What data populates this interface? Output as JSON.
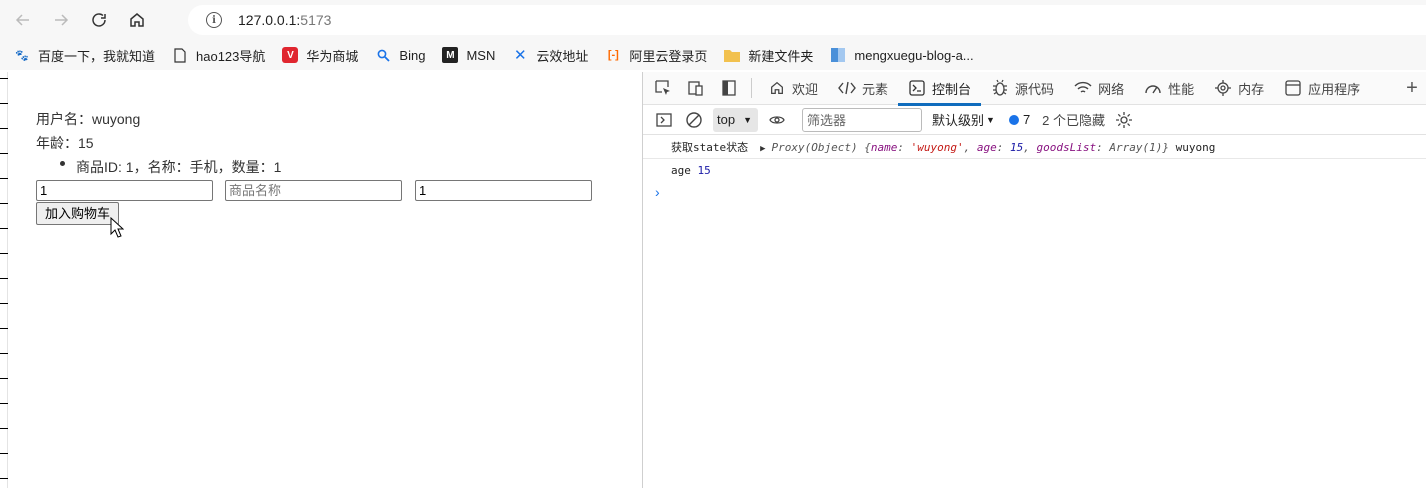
{
  "browser": {
    "address_host": "127.0.0.1:",
    "address_port": "5173"
  },
  "bookmarks": [
    {
      "label": "百度一下，我就知道",
      "icon": "baidu-icon"
    },
    {
      "label": "hao123导航",
      "icon": "page-icon"
    },
    {
      "label": "华为商城",
      "icon": "huawei-icon"
    },
    {
      "label": "Bing",
      "icon": "bing-search-icon"
    },
    {
      "label": "MSN",
      "icon": "msn-icon"
    },
    {
      "label": "云效地址",
      "icon": "yunxiao-icon"
    },
    {
      "label": "阿里云登录页",
      "icon": "aliyun-icon"
    },
    {
      "label": "新建文件夹",
      "icon": "folder-icon"
    },
    {
      "label": "mengxuegu-blog-a...",
      "icon": "app-icon"
    }
  ],
  "page": {
    "username_line": "用户名：wuyong",
    "age_line": "年龄：15",
    "goods_item": "商品ID: 1，名称：手机，数量：1",
    "input_id_value": "1",
    "input_name_placeholder": "商品名称",
    "input_qty_value": "1",
    "add_button": "加入购物车"
  },
  "devtools": {
    "tabs": [
      {
        "label": "欢迎",
        "icon": "home-icon"
      },
      {
        "label": "元素",
        "icon": "code-icon"
      },
      {
        "label": "控制台",
        "icon": "console-icon",
        "active": true
      },
      {
        "label": "源代码",
        "icon": "bug-icon"
      },
      {
        "label": "网络",
        "icon": "wifi-icon"
      },
      {
        "label": "性能",
        "icon": "performance-icon"
      },
      {
        "label": "内存",
        "icon": "memory-chip-icon"
      },
      {
        "label": "应用程序",
        "icon": "app-window-icon"
      }
    ],
    "context": "top",
    "filter_placeholder": "筛选器",
    "level": "默认级别",
    "issues_count": "7",
    "hidden_count": "2 个已隐藏",
    "accent": "#0f6cbd"
  },
  "console": {
    "line1_label": "获取state状态",
    "line1_proxy": "Proxy(Object)",
    "line1_open": "{",
    "line1_k1": "name",
    "line1_v1": "'wuyong'",
    "line1_k2": "age",
    "line1_v2": "15",
    "line1_k3": "goodsList",
    "line1_v3": "Array(1)",
    "line1_close": "}",
    "line1_tail": "wuyong",
    "line2_label": "age",
    "line2_value": "15"
  }
}
